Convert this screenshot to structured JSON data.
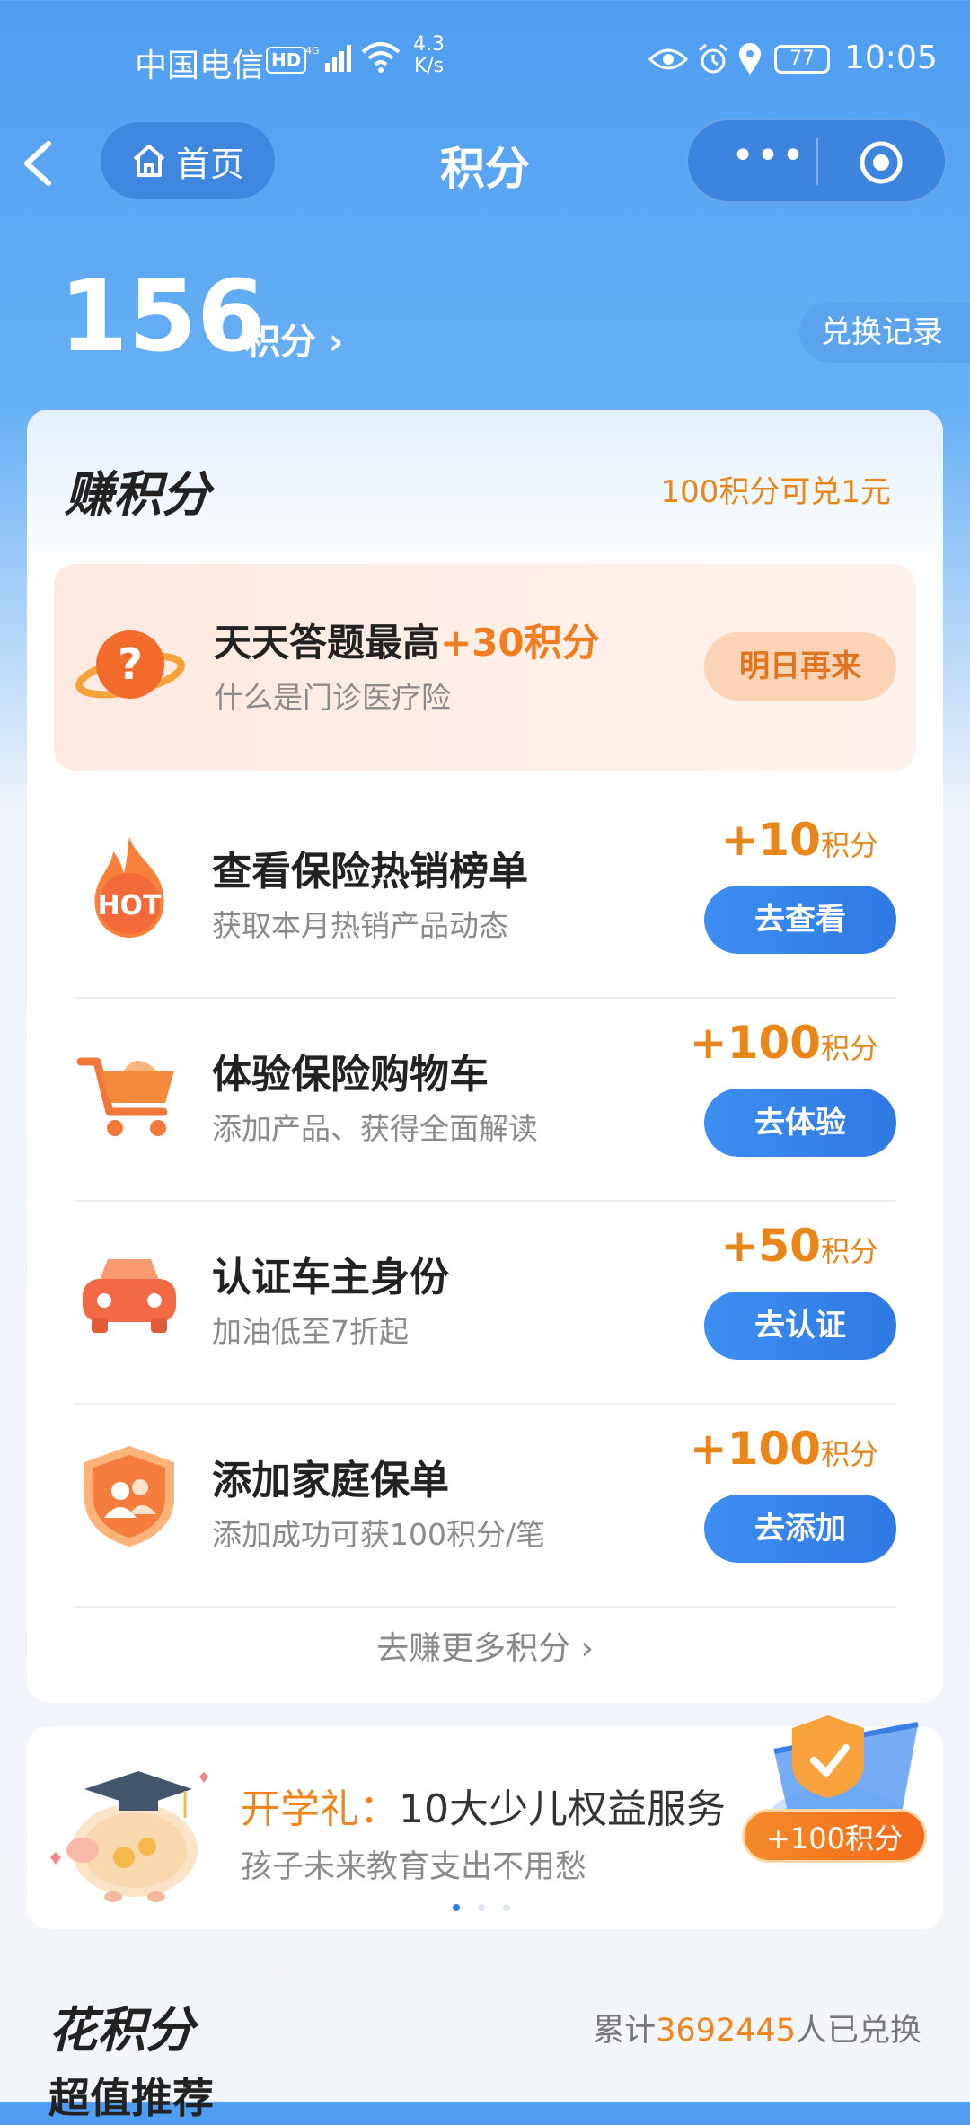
{
  "status_bar": {
    "carrier": "中国电信",
    "hd_badge": "HD",
    "net_speed_value": "4.3",
    "net_speed_unit": "K/s",
    "battery": "77",
    "time": "10:05"
  },
  "nav": {
    "home_label": "首页",
    "title": "积分"
  },
  "points": {
    "value": "156",
    "unit": "积分",
    "redeem_record": "兑换记录"
  },
  "earn": {
    "title": "赚积分",
    "rate": "100积分可兑1元",
    "quiz": {
      "title_prefix": "天天答题最高",
      "title_points": "+30积分",
      "subtitle": "什么是门诊医疗险",
      "button": "明日再来"
    },
    "tasks": [
      {
        "title": "查看保险热销榜单",
        "subtitle": "获取本月热销产品动态",
        "points": "+10",
        "unit": "积分",
        "button": "去查看"
      },
      {
        "title": "体验保险购物车",
        "subtitle": "添加产品、获得全面解读",
        "points": "+100",
        "unit": "积分",
        "button": "去体验"
      },
      {
        "title": "认证车主身份",
        "subtitle": "加油低至7折起",
        "points": "+50",
        "unit": "积分",
        "button": "去认证"
      },
      {
        "title": "添加家庭保单",
        "subtitle": "添加成功可获100积分/笔",
        "points": "+100",
        "unit": "积分",
        "button": "去添加"
      }
    ],
    "more_link": "去赚更多积分 ›"
  },
  "banner": {
    "title_highlight": "开学礼：",
    "title_rest": "10大少儿权益服务",
    "subtitle": "孩子未来教育支出不用愁",
    "badge": "+100积分",
    "pager_count": 3,
    "pager_active": 0
  },
  "spend": {
    "title": "花积分",
    "stat_prefix": "累计",
    "stat_number": "3692445",
    "stat_suffix": "人已兑换",
    "subtitle": "超值推荐"
  },
  "colors": {
    "brand_blue": "#3d8ef0",
    "accent_orange": "#e8861a"
  }
}
